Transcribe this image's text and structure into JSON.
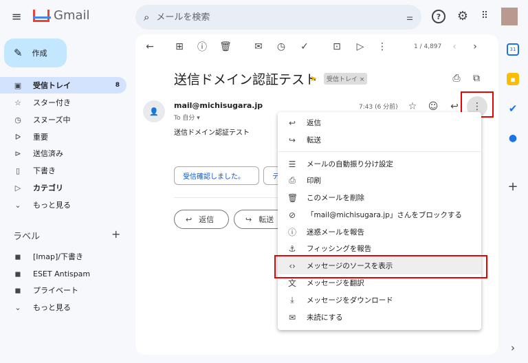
{
  "app": {
    "name": "Gmail"
  },
  "search": {
    "placeholder": "メールを検索"
  },
  "compose_label": "作成",
  "nav": [
    {
      "label": "受信トレイ",
      "icon": "inbox-icon",
      "count": "8"
    },
    {
      "label": "スター付き",
      "icon": "star-icon"
    },
    {
      "label": "スヌーズ中",
      "icon": "clock-icon"
    },
    {
      "label": "重要",
      "icon": "important-icon"
    },
    {
      "label": "送信済み",
      "icon": "send-icon"
    },
    {
      "label": "下書き",
      "icon": "draft-icon"
    },
    {
      "label": "カテゴリ",
      "icon": "label-icon"
    },
    {
      "label": "もっと見る",
      "icon": "chevron-down-icon"
    }
  ],
  "labels": {
    "heading": "ラベル",
    "items": [
      "[Imap]/下書き",
      "ESET Antispam",
      "プライベート"
    ],
    "more": "もっと見る"
  },
  "toolbar": {
    "pagination": "1 / 4,897"
  },
  "email": {
    "subject": "送信ドメイン認証テスト",
    "tag": "受信トレイ ×",
    "sender": "mail@michisugara.jp",
    "to": "To 自分 ▾",
    "time": "7:43 (6 分前)",
    "body": "送信ドメイン認証テスト"
  },
  "smart_replies": [
    "受信確認しました。",
    "テ"
  ],
  "actions": {
    "reply": "返信",
    "forward": "転送"
  },
  "menu": {
    "items": [
      {
        "label": "返信",
        "icon": "reply-icon"
      },
      {
        "label": "転送",
        "icon": "forward-icon"
      },
      {
        "label": "メールの自動振り分け設定",
        "icon": "filter-icon"
      },
      {
        "label": "印刷",
        "icon": "print-icon"
      },
      {
        "label": "このメールを削除",
        "icon": "trash-icon"
      },
      {
        "label": "「mail@michisugara.jp」さんをブロックする",
        "icon": "block-icon"
      },
      {
        "label": "迷惑メールを報告",
        "icon": "spam-icon"
      },
      {
        "label": "フィッシングを報告",
        "icon": "phishing-icon"
      },
      {
        "label": "メッセージのソースを表示",
        "icon": "code-icon"
      },
      {
        "label": "メッセージを翻訳",
        "icon": "translate-icon"
      },
      {
        "label": "メッセージをダウンロード",
        "icon": "download-icon"
      },
      {
        "label": "未読にする",
        "icon": "mark-unread-icon"
      }
    ]
  },
  "colors": {
    "highlight": "#ee0000",
    "accent": "#c2e7ff"
  }
}
